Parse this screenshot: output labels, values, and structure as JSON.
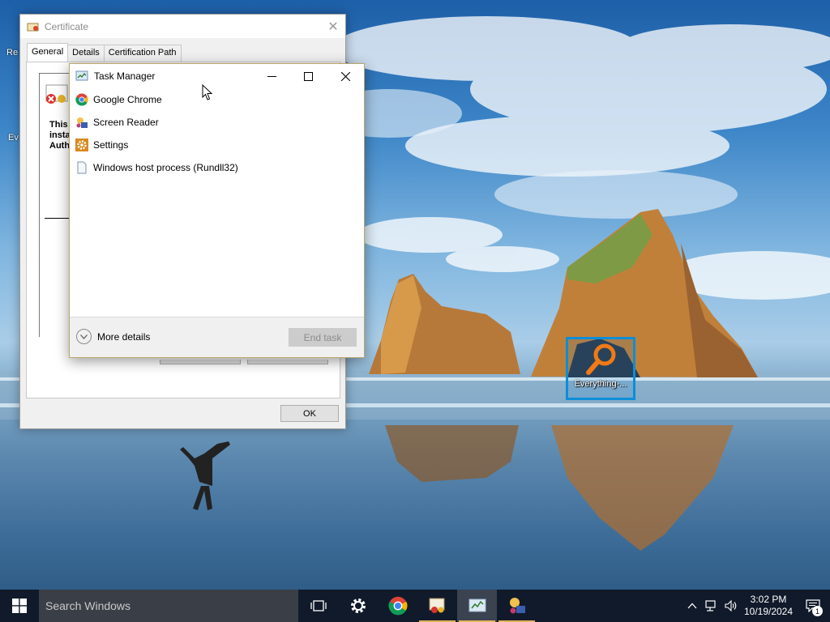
{
  "desktop": {
    "icons": [
      {
        "label": "Everything-..."
      }
    ],
    "partial_left_labels": [
      "Re",
      "Ev"
    ]
  },
  "certificate_window": {
    "title": "Certificate",
    "close_glyph": "✕",
    "tabs": [
      "General",
      "Details",
      "Certification Path"
    ],
    "active_tab": "General",
    "body_text_lines": [
      "This",
      "insta",
      "Auth"
    ],
    "ok_label": "OK"
  },
  "task_manager": {
    "title": "Task Manager",
    "processes": [
      {
        "name": "Google Chrome",
        "icon": "chrome-icon"
      },
      {
        "name": "Screen Reader",
        "icon": "screen-reader-icon"
      },
      {
        "name": "Settings",
        "icon": "settings-gear-icon"
      },
      {
        "name": "Windows host process (Rundll32)",
        "icon": "document-icon"
      }
    ],
    "more_details_label": "More details",
    "end_task_label": "End task"
  },
  "taskbar": {
    "search_placeholder": "Search Windows",
    "pinned": [
      "task-view-icon",
      "settings-icon",
      "chrome-icon",
      "certificate-icon",
      "task-manager-icon",
      "screen-reader-icon"
    ],
    "active_item": "task-manager-icon",
    "clock_time": "3:02 PM",
    "clock_date": "10/19/2024",
    "notification_count": "1"
  },
  "colors": {
    "taskbar_bg": "#101a2a",
    "search_bg": "#3a3f47",
    "selection": "#0b8ed8",
    "taskbar_active_underline": "#e2b25c"
  }
}
